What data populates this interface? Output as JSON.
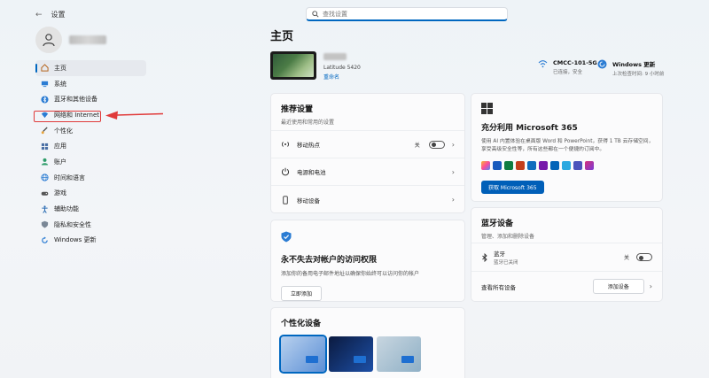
{
  "window": {
    "title": "设置"
  },
  "search": {
    "placeholder": "查找设置"
  },
  "sidebar": {
    "items": [
      {
        "label": "主页",
        "icon": "home-icon",
        "active": true
      },
      {
        "label": "系统",
        "icon": "monitor-icon"
      },
      {
        "label": "蓝牙和其他设备",
        "icon": "bluetooth-icon"
      },
      {
        "label": "网络和 Internet",
        "icon": "wifi-icon"
      },
      {
        "label": "个性化",
        "icon": "brush-icon"
      },
      {
        "label": "应用",
        "icon": "apps-icon"
      },
      {
        "label": "账户",
        "icon": "account-icon"
      },
      {
        "label": "时间和语言",
        "icon": "globe-icon"
      },
      {
        "label": "游戏",
        "icon": "gamepad-icon"
      },
      {
        "label": "辅助功能",
        "icon": "accessibility-icon"
      },
      {
        "label": "隐私和安全性",
        "icon": "shield-icon"
      },
      {
        "label": "Windows 更新",
        "icon": "update-icon"
      }
    ]
  },
  "main": {
    "title": "主页",
    "device": {
      "model": "Latitude 5420",
      "rename": "重命名"
    },
    "status": {
      "wifi": {
        "title": "CMCC-101-5G",
        "sub": "已连接，安全"
      },
      "update": {
        "title": "Windows 更新",
        "sub": "上次检查时间: 9 小时前"
      }
    },
    "recommended": {
      "title": "推荐设置",
      "sub": "最近使用和常用的设置",
      "rows": [
        {
          "label": "移动热点",
          "toggle_label": "关"
        },
        {
          "label": "电源和电池"
        },
        {
          "label": "移动设备"
        }
      ]
    },
    "account": {
      "title": "永不失去对帐户的访问权限",
      "sub": "添加你的备用电子邮件地址以确保你始终可以访问你的帐户",
      "button": "立即添加"
    },
    "personalize": {
      "title": "个性化设备"
    },
    "m365": {
      "title": "充分利用 Microsoft 365",
      "sub": "使用 AI 内置体验在桌面版 Word 和 PowerPoint，获得 1 TB 云存储空间，享受高级安全性等，所有这些都在一个便捷的订阅中。",
      "button": "获取 Microsoft 365"
    },
    "bluetooth": {
      "title": "蓝牙设备",
      "sub": "管理、添加和删除设备",
      "row": {
        "label": "蓝牙",
        "sub": "蓝牙已关闭",
        "toggle_label": "关"
      },
      "footer": {
        "label": "查看所有设备",
        "button": "添加设备"
      }
    }
  },
  "colors": {
    "accent": "#0067c0",
    "highlight": "#e03a3a"
  }
}
